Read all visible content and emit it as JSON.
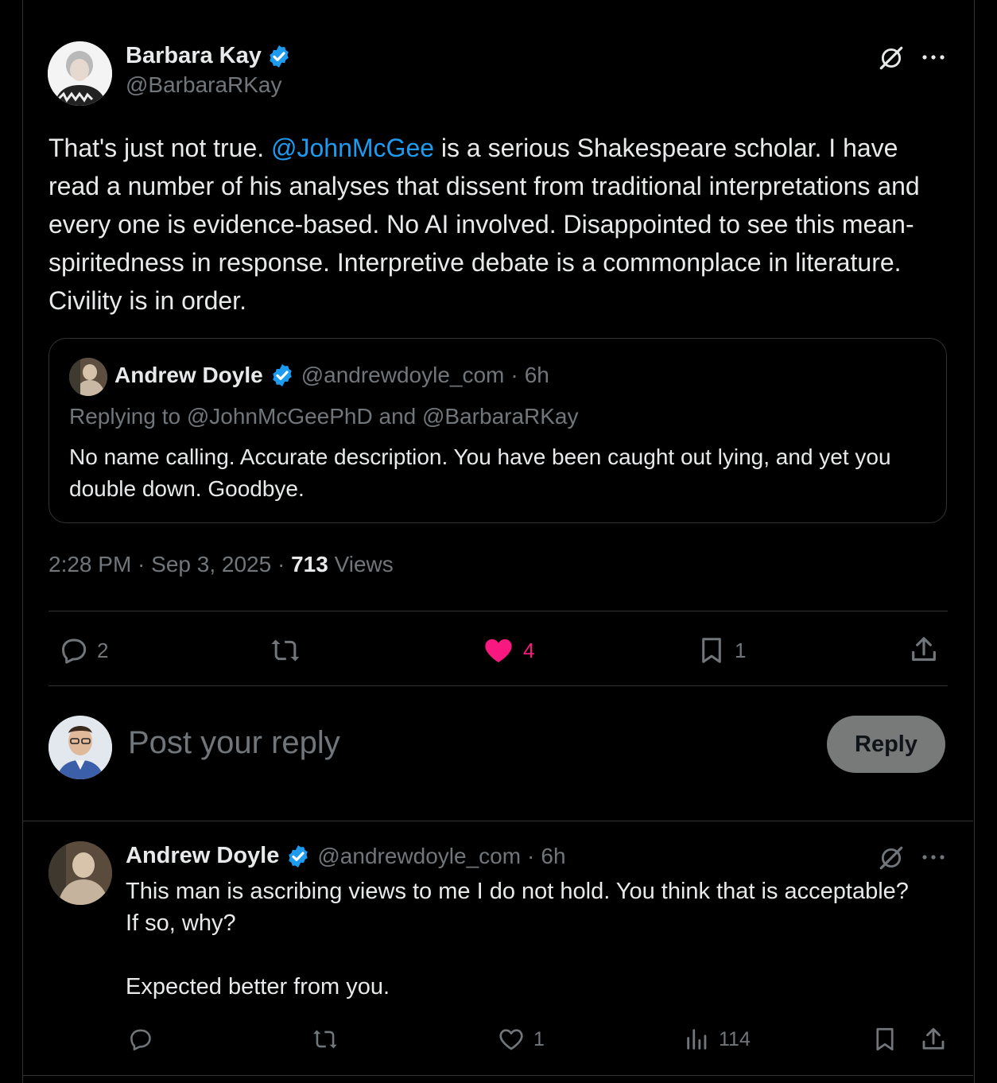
{
  "main_post": {
    "author_name": "Barbara Kay",
    "author_handle": "@BarbaraRKay",
    "text_before_mention": "That's just not true. ",
    "mention": "@JohnMcGee",
    "text_after_mention": " is a serious Shakespeare scholar. I have read a number of his  analyses that dissent from traditional interpretations and every one is evidence-based. No AI involved. Disappointed to see this mean-spiritedness in response. Interpretive debate is a commonplace in literature. Civility is in order.",
    "quoted": {
      "author_name": "Andrew Doyle",
      "author_handle": "@andrewdoyle_com",
      "time": "6h",
      "replying_to": "Replying to @JohnMcGeePhD and @BarbaraRKay",
      "text": "No name calling. Accurate description. You have been caught out lying, and yet you double down. Goodbye."
    },
    "timestamp": "2:28 PM · Sep 3, 2025",
    "views_count": "713",
    "views_label": "Views",
    "actions": {
      "replies": "2",
      "reposts": "",
      "likes": "4",
      "bookmarks": "1"
    }
  },
  "reply_box": {
    "placeholder": "Post your reply",
    "button_label": "Reply"
  },
  "reply_post": {
    "author_name": "Andrew Doyle",
    "author_handle": "@andrewdoyle_com",
    "time": "6h",
    "text": "This man is ascribing views to me I do not hold. You think that is acceptable? If so, why?\n\nExpected better from you.",
    "actions": {
      "replies": "",
      "reposts": "",
      "likes": "1",
      "views": "114"
    }
  },
  "colors": {
    "accent_blue": "#1d9bf0",
    "like_pink": "#f91880",
    "muted": "#71767b",
    "border": "#2f3336"
  }
}
